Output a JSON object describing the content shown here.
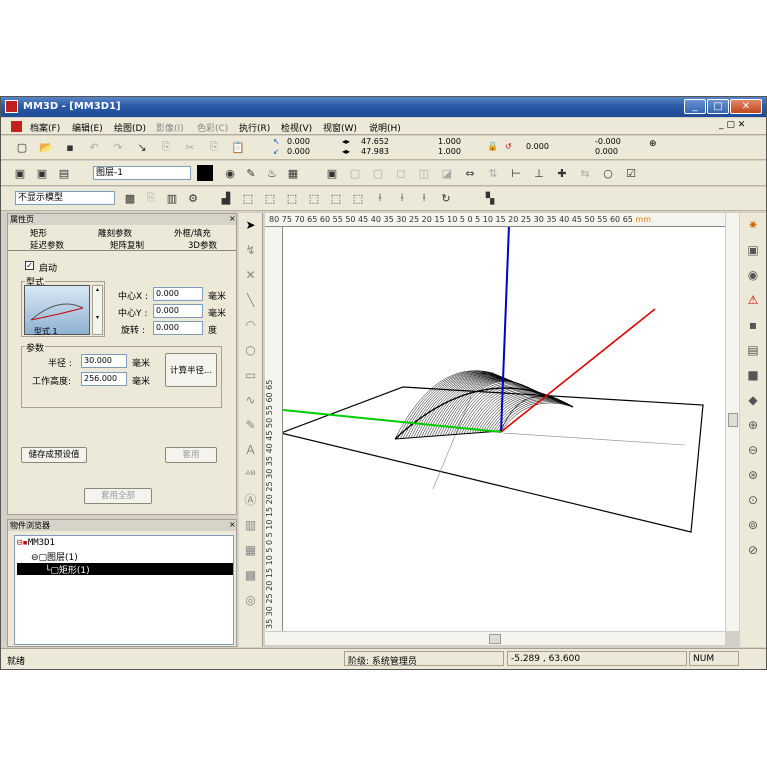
{
  "window": {
    "title": "MM3D - [MM3D1]",
    "min": "_",
    "max": "□",
    "close": "✕"
  },
  "menu": [
    "档案(F)",
    "编辑(E)",
    "绘图(D)",
    "影像(I)",
    "色彩(C)",
    "执行(R)",
    "检视(V)",
    "视窗(W)",
    "说明(H)"
  ],
  "toolbar": {
    "layer": "图层-1",
    "model_mode": "不显示模型",
    "coords": {
      "x": "0.000",
      "y": "0.000",
      "w": "47.652",
      "h": "47.983",
      "sx": "1.000",
      "sy": "1.000",
      "rot": "0.000",
      "sk1": "-0.000",
      "sk2": "0.000"
    }
  },
  "props": {
    "title": "属性页",
    "tabs_row1": [
      "矩形",
      "雕刻参数",
      "外框/填充"
    ],
    "tabs_row2": [
      "延迟参数",
      "矩阵复制",
      "3D参数"
    ],
    "enable": "启动",
    "style_group": "型式",
    "style_name": "型式 1",
    "cx_label": "中心X :",
    "cx": "0.000",
    "cy_label": "中心Y :",
    "cy": "0.000",
    "rot_label": "旋转 :",
    "rot": "0.000",
    "unit_mm": "毫米",
    "unit_deg": "度",
    "param_group": "参数",
    "radius_label": "半径 :",
    "radius": "30.000",
    "height_label": "工作高度:",
    "height": "256.000",
    "calc_radius": "计算半径...",
    "save_default": "储存成预设值",
    "apply": "套用",
    "apply_all": "套用全部"
  },
  "browser": {
    "title": "物件浏览器",
    "root": "MM3D1",
    "layer": "图层(1)",
    "item": "矩形(1)"
  },
  "ruler": {
    "top": "80 75 70 65 60 55 50 45 40 35 30 25 20 15 10 5  0  5  10 15 20 25 30 35 40 45 50 55 60 65",
    "unit": "mm",
    "left": "35 30 25 20 15 10 5 0 5 10 15 20 25 30 35 40 45 50 55 60 65"
  },
  "status": {
    "ready": "就绪",
    "user": "阶级: 系统管理员",
    "coords": "-5.289 , 63.600",
    "num": "NUM"
  }
}
